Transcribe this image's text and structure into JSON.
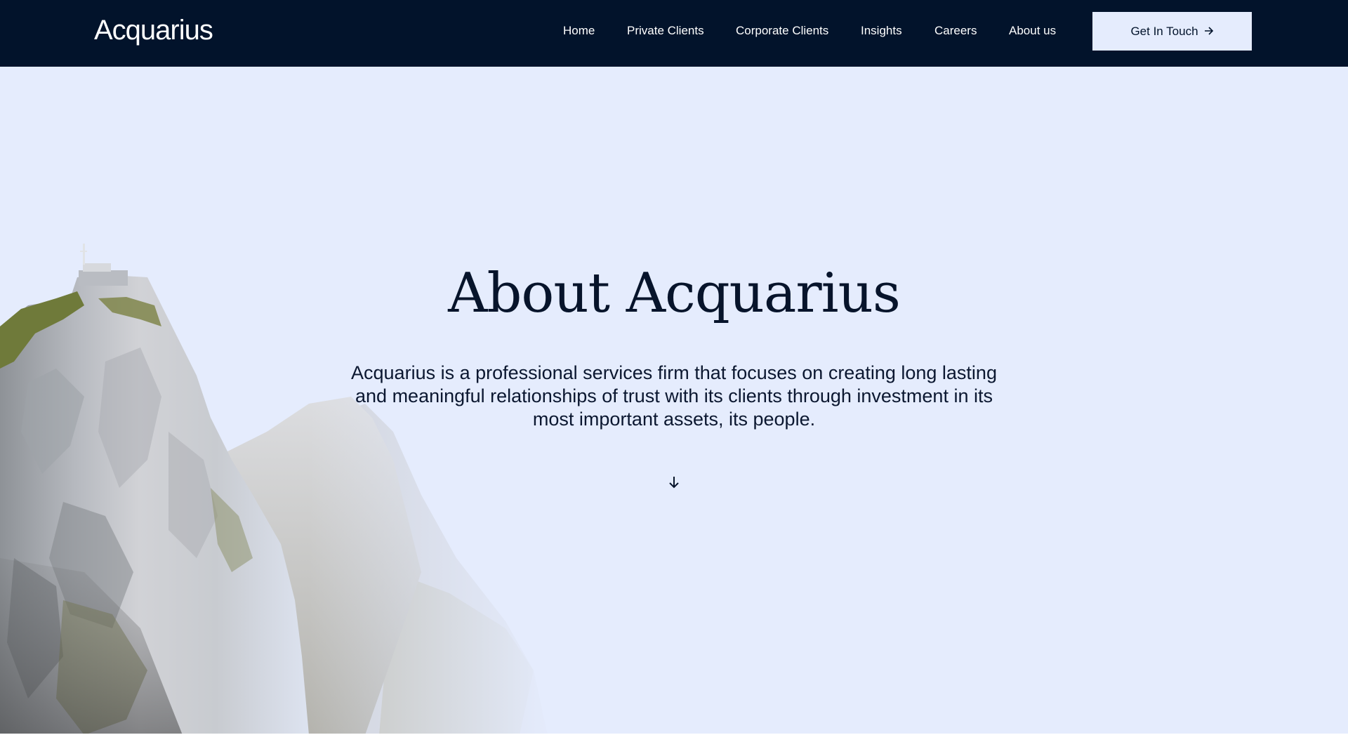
{
  "brand": {
    "name": "Acquarius",
    "colors": {
      "nav_background": "#02132b",
      "hero_background": "#e5ecfd",
      "text_dark": "#07142b",
      "cta_background": "#e5ecfd"
    }
  },
  "nav": {
    "items": [
      {
        "label": "Home"
      },
      {
        "label": "Private Clients"
      },
      {
        "label": "Corporate Clients"
      },
      {
        "label": "Insights"
      },
      {
        "label": "Careers"
      },
      {
        "label": "About us"
      }
    ],
    "cta": {
      "label": "Get In Touch",
      "icon": "arrow-right-icon"
    }
  },
  "hero": {
    "title": "About Acquarius",
    "description": "Acquarius is a professional services firm that focuses on creating long lasting and meaningful relationships of trust with its clients through investment in its most important assets, its people.",
    "scroll_icon": "arrow-down-icon",
    "image": "mountain-cliff-image"
  }
}
